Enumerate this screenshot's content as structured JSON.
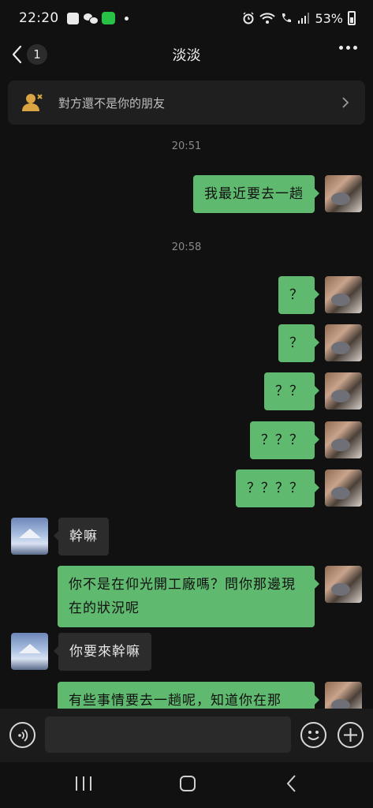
{
  "status_bar": {
    "time": "22:20",
    "battery": "53%",
    "icons": [
      "gallery-icon",
      "wechat-icon",
      "line-icon",
      "dot-icon",
      "alarm-icon",
      "wifi-icon",
      "call-icon",
      "signal-icon",
      "battery-icon"
    ]
  },
  "header": {
    "unread_count": "1",
    "title": "淡淡",
    "icons": [
      "back-arrow-icon",
      "more-icon"
    ]
  },
  "notice": {
    "text": "對方還不是你的朋友",
    "icons": [
      "add-friend-icon",
      "chevron-right-icon"
    ]
  },
  "chat": {
    "timestamps": [
      "20:51",
      "20:58"
    ],
    "messages": [
      {
        "sender": "me",
        "text": "我最近要去一趟"
      },
      {
        "sender": "me",
        "text": "？"
      },
      {
        "sender": "me",
        "text": "？"
      },
      {
        "sender": "me",
        "text": "？？"
      },
      {
        "sender": "me",
        "text": "？？？"
      },
      {
        "sender": "me",
        "text": "？？？？"
      },
      {
        "sender": "them",
        "text": "幹嘛"
      },
      {
        "sender": "me",
        "text": "你不是在仰光開工廠嗎？問你那邊現在的狀況呢"
      },
      {
        "sender": "them",
        "text": "你要來幹嘛"
      },
      {
        "sender": "me",
        "text": "有些事情要去一趟呢，知道你在那"
      }
    ]
  },
  "input_bar": {
    "text_value": "",
    "icons": [
      "voice-icon",
      "emoji-icon",
      "plus-icon"
    ]
  },
  "nav_bar": {
    "icons": [
      "recents-icon",
      "home-icon",
      "back-icon"
    ]
  },
  "colors": {
    "background": "#111111",
    "my_bubble": "#5fb96e",
    "their_bubble": "#2c2c2c",
    "notice_bg": "#1f1f1f",
    "accent": "#d9a441"
  }
}
